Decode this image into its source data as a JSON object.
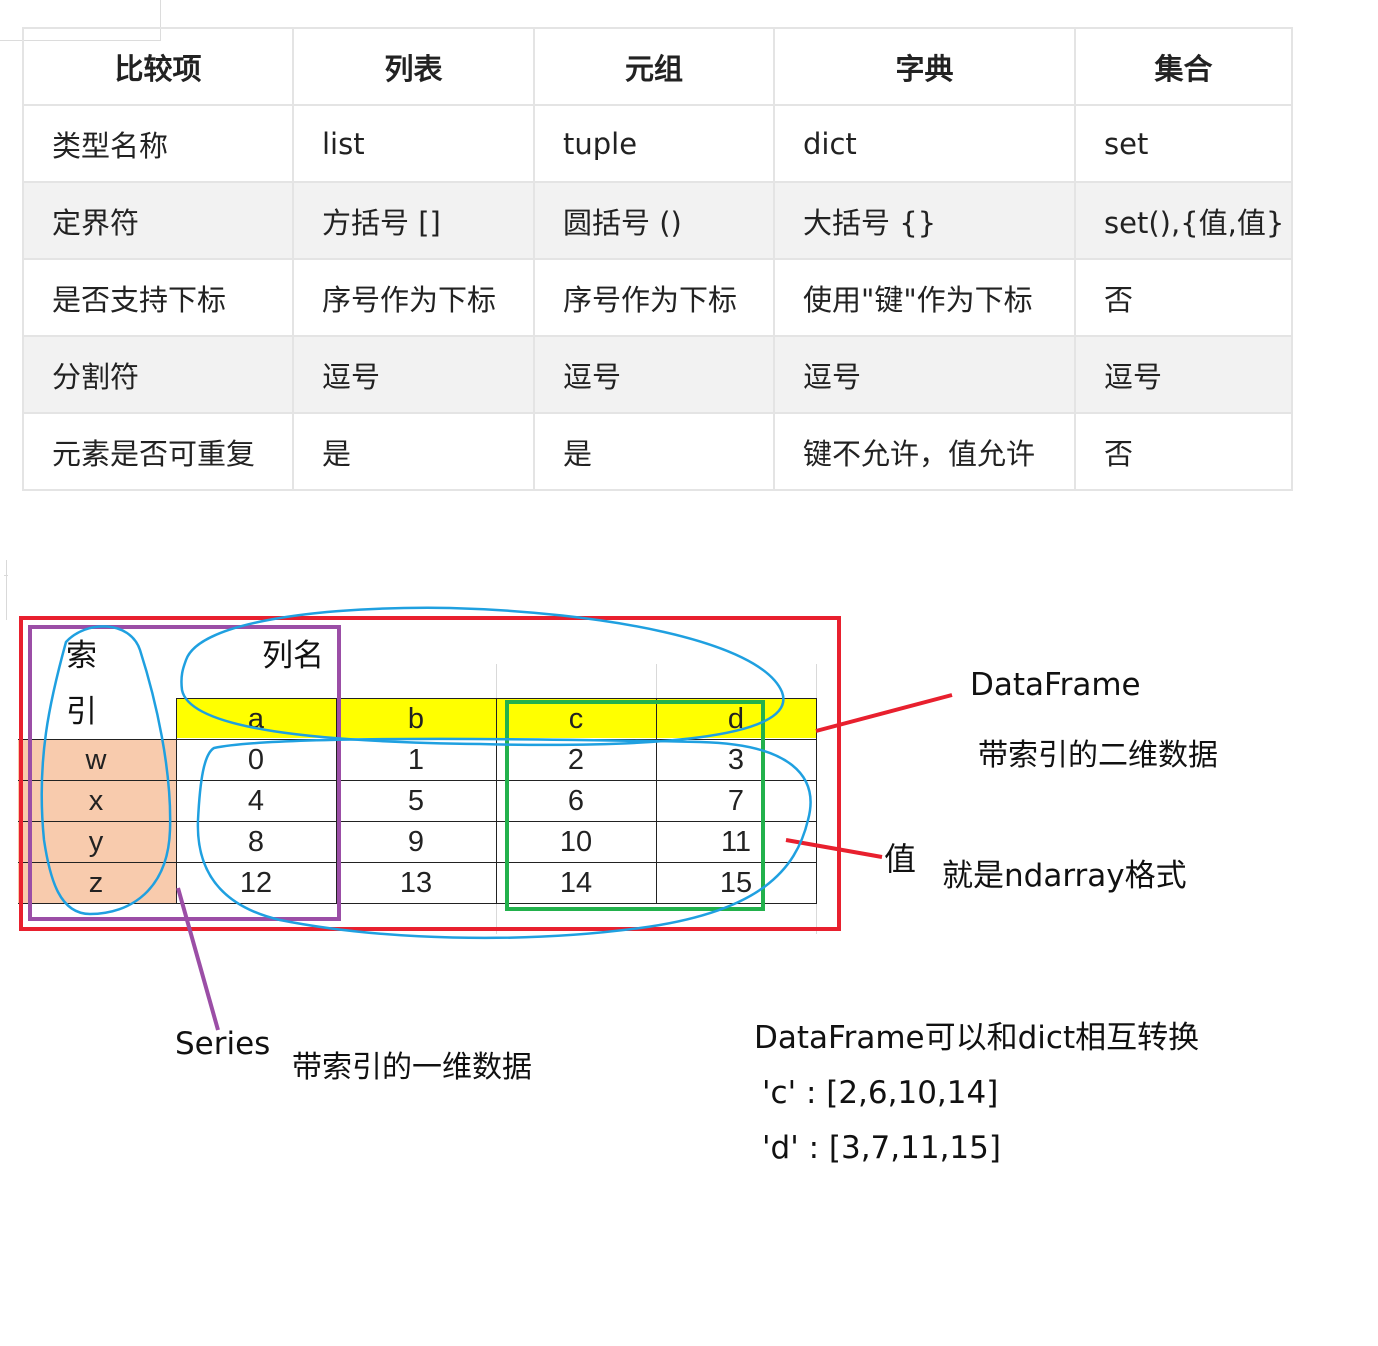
{
  "comparison_table": {
    "headers": [
      "比较项",
      "列表",
      "元组",
      "字典",
      "集合"
    ],
    "rows": [
      [
        "类型名称",
        "list",
        "tuple",
        "dict",
        "set"
      ],
      [
        "定界符",
        "方括号 []",
        "圆括号 ()",
        "大括号 {}",
        "set(),{值,值}"
      ],
      [
        "是否支持下标",
        "序号作为下标",
        "序号作为下标",
        "使用\"键\"作为下标",
        "否"
      ],
      [
        "分割符",
        "逗号",
        "逗号",
        "逗号",
        "逗号"
      ],
      [
        "元素是否可重复",
        "是",
        "是",
        "键不允许，值允许",
        "否"
      ]
    ]
  },
  "dataframe": {
    "index_label_line1": "索",
    "index_label_line2": "引",
    "columns_label": "列名",
    "columns": [
      "a",
      "b",
      "c",
      "d"
    ],
    "index": [
      "w",
      "x",
      "y",
      "z"
    ],
    "values": [
      [
        "0",
        "1",
        "2",
        "3"
      ],
      [
        "4",
        "5",
        "6",
        "7"
      ],
      [
        "8",
        "9",
        "10",
        "11"
      ],
      [
        "12",
        "13",
        "14",
        "15"
      ]
    ]
  },
  "annotations": {
    "dataframe_title": "DataFrame",
    "dataframe_desc": "带索引的二维数据",
    "values_title": "值",
    "values_desc": "就是ndarray格式",
    "series_title": "Series",
    "series_desc": "带索引的一维数据",
    "dict_note": "DataFrame可以和dict相互转换",
    "dict_line1": "'c' : [2,6,10,14]",
    "dict_line2": "'d' : [3,7,11,15]"
  },
  "colors": {
    "frame_red": "#e8202e",
    "index_purple": "#9b4ea6",
    "col_green": "#22b14c",
    "ink_blue": "#1fa0e0",
    "header_yellow": "#ffff00",
    "index_peach": "#f8cbad"
  }
}
